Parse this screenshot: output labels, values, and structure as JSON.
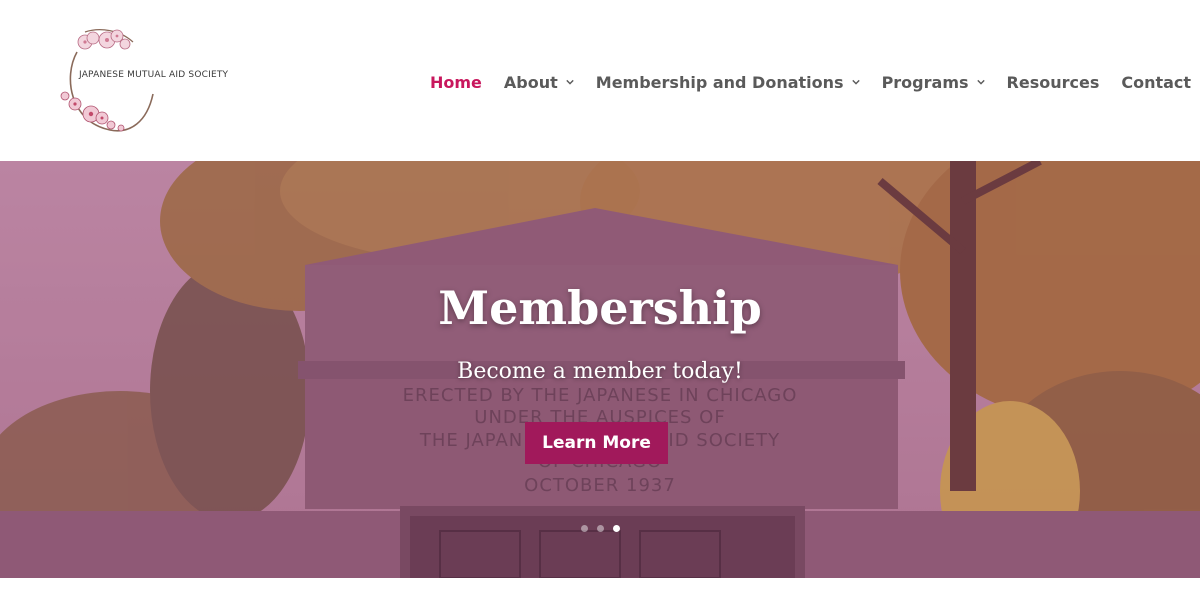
{
  "logo": {
    "text": "JAPANESE MUTUAL AID SOCIETY",
    "icon": "cherry-blossom-wreath"
  },
  "nav": {
    "items": [
      {
        "label": "Home",
        "active": true,
        "dropdown": false
      },
      {
        "label": "About",
        "active": false,
        "dropdown": true
      },
      {
        "label": "Membership and Donations",
        "active": false,
        "dropdown": true
      },
      {
        "label": "Programs",
        "active": false,
        "dropdown": true
      },
      {
        "label": "Resources",
        "active": false,
        "dropdown": false
      },
      {
        "label": "Contact",
        "active": false,
        "dropdown": false
      }
    ]
  },
  "hero": {
    "title": "Membership",
    "subtitle": "Become a member today!",
    "button_label": "Learn More",
    "monument_lines": [
      "ERECTED BY THE JAPANESE IN CHICAGO",
      "UNDER THE AUSPICES OF",
      "THE JAPANESE MUTUAL AID SOCIETY",
      "OF CHICAGO",
      "OCTOBER 1937"
    ],
    "slides_count": 3,
    "active_slide": 3
  },
  "colors": {
    "accent": "#c8175d",
    "button": "#a1195b",
    "nav_text": "#5a5a5a"
  }
}
